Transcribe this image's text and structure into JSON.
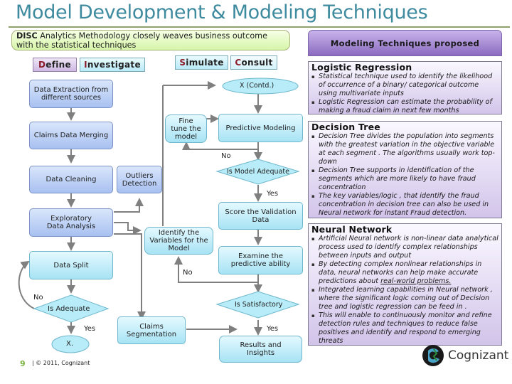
{
  "title": "Model Development & Modeling Techniques",
  "intro": {
    "bold": "DISC",
    "text": " Analytics Methodology closely weaves business outcome with the statistical techniques"
  },
  "phases": [
    {
      "first": "D",
      "rest": "efine"
    },
    {
      "first": "I",
      "rest": "nvestigate"
    },
    {
      "first": "S",
      "rest": "imulate"
    },
    {
      "first": "C",
      "rest": "onsult"
    }
  ],
  "flow": {
    "data_extraction": "Data Extraction from different sources",
    "claims_merging": "Claims Data Merging",
    "data_cleaning": "Data Cleaning",
    "outliers": "Outliers Detection",
    "eda": "Exploratory Data Analysis",
    "data_split": "Data Split",
    "is_adequate": "Is Adequate",
    "x_end": "X.",
    "identify_vars": "Identify the Variables for the Model",
    "claims_segmentation": "Claims Segmentation",
    "x_contd": "X (Contd.)",
    "fine_tune": "Fine tune the model",
    "predictive_modeling": "Predictive Modeling",
    "is_model_adequate": "Is Model Adequate",
    "score_validation": "Score the Validation Data",
    "examine_predictive": "Examine the predictive ability",
    "is_satisfactory": "Is Satisfactory",
    "results": "Results and Insights",
    "labels": {
      "no_model": "No",
      "yes_model": "Yes",
      "no_examine": "No",
      "no_adequate": "No",
      "yes_adequate": "Yes",
      "yes_satisfactory": "Yes"
    }
  },
  "techniques": {
    "header": "Modeling Techniques proposed",
    "sections": [
      {
        "title": "Logistic Regression",
        "bullets": [
          "Statistical technique used to identify the likelihood of occurrence of a binary/ categorical outcome using multivariate inputs",
          "Logistic Regression can estimate the probability of making a fraud claim in next few months"
        ]
      },
      {
        "title": "Decision Tree",
        "bullets": [
          "Decision Tree divides the population into segments with the greatest variation in the objective variable at each segment . The algorithms usually work top-down",
          "Decision Tree supports in identification of the segments which are more likely to have fraud concentration",
          "The key variables/logic , that identify the fraud concentration in decision tree can also be used in Neural network for instant Fraud detection."
        ]
      },
      {
        "title": "Neural Network",
        "bullets": [
          "Artificial Neural network is non-linear data analytical process used to identify complex relationships between inputs and output",
          "By detecting complex nonlinear relationships in data, neural networks can help make accurate predictions about ",
          "Integrated learning capabilities in Neural network , where the significant logic coming out of Decision tree and logistic regression can be feed in .",
          "This will enable to continuously monitor and refine detection rules and techniques to reduce false positives and identify and respond to emerging threats"
        ],
        "underlined": "real-world problems."
      }
    ]
  },
  "footer": {
    "page": "9",
    "text": "|  © 2011, Cognizant"
  },
  "logo": "Cognizant",
  "colors": {
    "title": "#3e8a9e",
    "accent_purple": "#8c6bc0",
    "flow_blue": "#a8c1f1",
    "flow_cyan": "#a7e3f4",
    "connector": "#7f7f7f"
  }
}
